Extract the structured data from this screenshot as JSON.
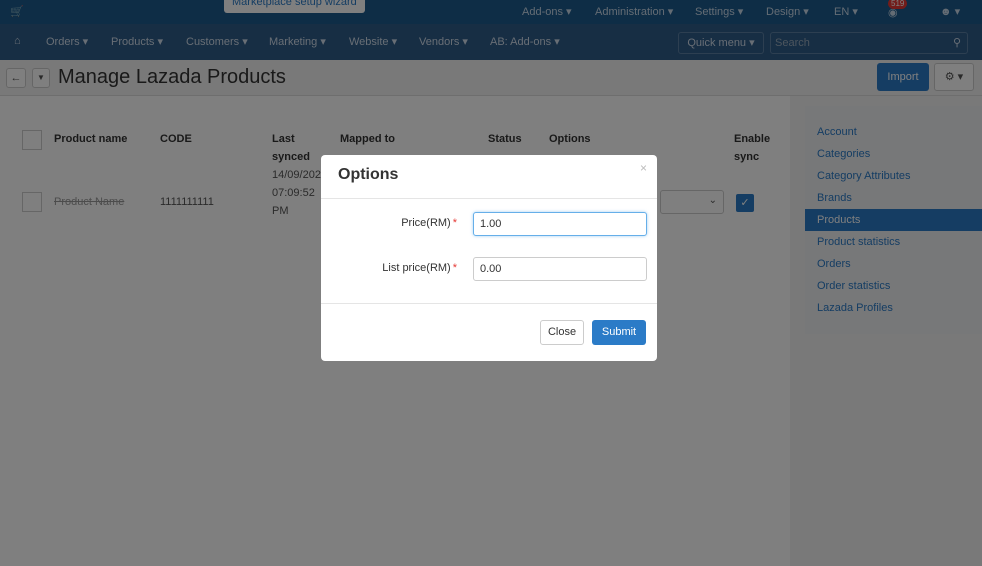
{
  "topbar": {
    "cart_icon": "cart-icon",
    "wizard_label": "Marketplace setup wizard",
    "addons": "Add-ons ▾",
    "administration": "Administration ▾",
    "settings": "Settings ▾",
    "design": "Design ▾",
    "language": "EN ▾",
    "notifications_count": "519",
    "user_icon": "user-icon"
  },
  "menubar": {
    "items": [
      "Orders ▾",
      "Products ▾",
      "Customers ▾",
      "Marketing ▾",
      "Website ▾",
      "Vendors ▾",
      "AB: Add-ons ▾"
    ],
    "quick_menu": "Quick menu ▾",
    "search_placeholder": "Search"
  },
  "header": {
    "title": "Manage Lazada Products",
    "import_label": "Import"
  },
  "table": {
    "columns": [
      "Product name",
      "CODE",
      "Last synced",
      "Mapped to",
      "Status",
      "Options",
      "Enable sync"
    ],
    "rows": [
      {
        "product_name": "Product Name",
        "code": "1111111111",
        "last_synced_1": "14/09/202",
        "last_synced_2": "07:09:52",
        "last_synced_3": "PM"
      }
    ]
  },
  "sidebar": {
    "items": [
      "Account",
      "Categories",
      "Category Attributes",
      "Brands",
      "Products",
      "Product statistics",
      "Orders",
      "Order statistics",
      "Lazada Profiles"
    ],
    "active": "Products"
  },
  "modal": {
    "title": "Options",
    "close_glyph": "×",
    "price_label": "Price(RM)",
    "price_value": "1.00",
    "list_price_label": "List price(RM)",
    "list_price_value": "0.00",
    "required_mark": "*",
    "close_label": "Close",
    "submit_label": "Submit"
  },
  "colors": {
    "topbar": "#1c5a8c",
    "menubar": "#2e5c88",
    "accent": "#2b7bc7"
  }
}
